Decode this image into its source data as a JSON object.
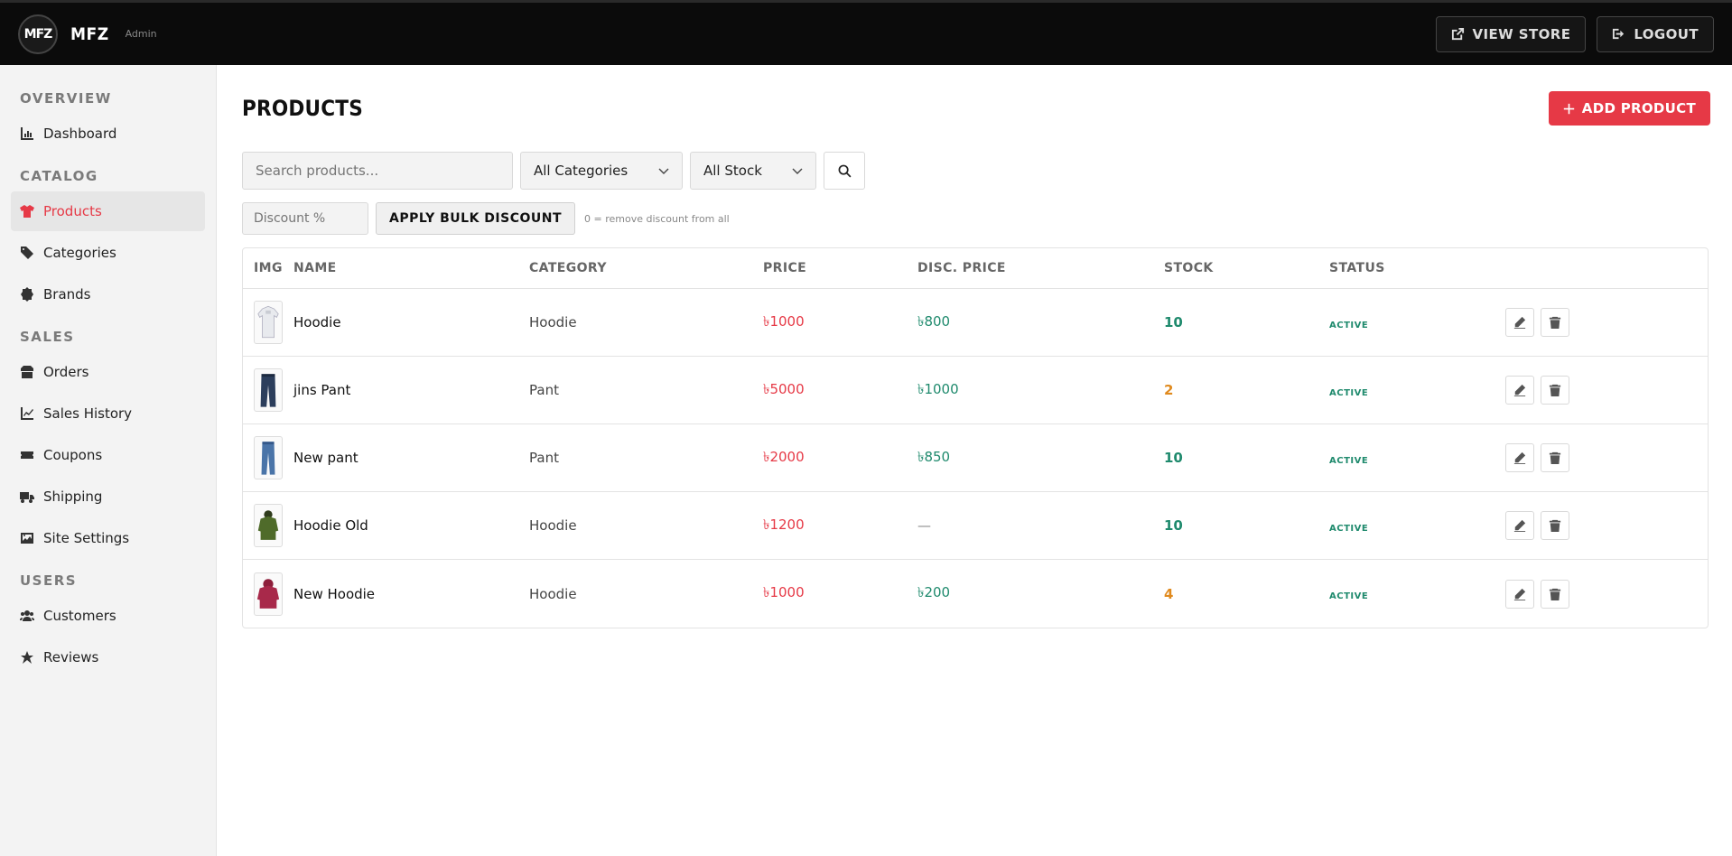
{
  "header": {
    "logo_text": "MFZ",
    "brand_name": "MFZ",
    "brand_tag": "Admin",
    "view_store_label": "VIEW STORE",
    "logout_label": "LOGOUT"
  },
  "sidebar": {
    "sections": [
      {
        "title": "OVERVIEW",
        "items": [
          {
            "label": "Dashboard",
            "icon": "chart-bar-icon"
          }
        ]
      },
      {
        "title": "CATALOG",
        "items": [
          {
            "label": "Products",
            "icon": "shirt-icon",
            "active": true
          },
          {
            "label": "Categories",
            "icon": "tags-icon"
          },
          {
            "label": "Brands",
            "icon": "badge-icon"
          }
        ]
      },
      {
        "title": "SALES",
        "items": [
          {
            "label": "Orders",
            "icon": "box-icon"
          },
          {
            "label": "Sales History",
            "icon": "chart-line-icon"
          },
          {
            "label": "Coupons",
            "icon": "ticket-icon"
          },
          {
            "label": "Shipping",
            "icon": "truck-icon"
          },
          {
            "label": "Site Settings",
            "icon": "image-icon"
          }
        ]
      },
      {
        "title": "USERS",
        "items": [
          {
            "label": "Customers",
            "icon": "users-icon"
          },
          {
            "label": "Reviews",
            "icon": "star-icon"
          }
        ]
      }
    ]
  },
  "main": {
    "title": "PRODUCTS",
    "add_label": "ADD PRODUCT",
    "search_placeholder": "Search products...",
    "category_select": "All Categories",
    "stock_select": "All Stock",
    "discount_placeholder": "Discount %",
    "bulk_label": "APPLY BULK DISCOUNT",
    "bulk_note": "0 = remove discount from all"
  },
  "table": {
    "headers": {
      "img": "IMG",
      "name": "NAME",
      "category": "CATEGORY",
      "price": "PRICE",
      "disc_price": "DISC. PRICE",
      "stock": "STOCK",
      "status": "STATUS"
    },
    "rows": [
      {
        "name": "Hoodie",
        "category": "Hoodie",
        "price": "৳1000",
        "disc_price": "৳800",
        "stock": "10",
        "stock_level": "ok",
        "status": "ACTIVE",
        "thumb": "white-hoodie"
      },
      {
        "name": "jins Pant",
        "category": "Pant",
        "price": "৳5000",
        "disc_price": "৳1000",
        "stock": "2",
        "stock_level": "low",
        "status": "ACTIVE",
        "thumb": "dark-jeans"
      },
      {
        "name": "New pant",
        "category": "Pant",
        "price": "৳2000",
        "disc_price": "৳850",
        "stock": "10",
        "stock_level": "ok",
        "status": "ACTIVE",
        "thumb": "blue-jeans"
      },
      {
        "name": "Hoodie Old",
        "category": "Hoodie",
        "price": "৳1200",
        "disc_price": "—",
        "stock": "10",
        "stock_level": "ok",
        "status": "ACTIVE",
        "thumb": "green-jacket"
      },
      {
        "name": "New Hoodie",
        "category": "Hoodie",
        "price": "৳1000",
        "disc_price": "৳200",
        "stock": "4",
        "stock_level": "low",
        "status": "ACTIVE",
        "thumb": "red-hoodie"
      }
    ]
  },
  "colors": {
    "accent": "#e63946",
    "success": "#1f8a6d",
    "warning": "#e08a1e",
    "topbar": "#0b0b0b",
    "sidebar": "#f3f3f3"
  }
}
